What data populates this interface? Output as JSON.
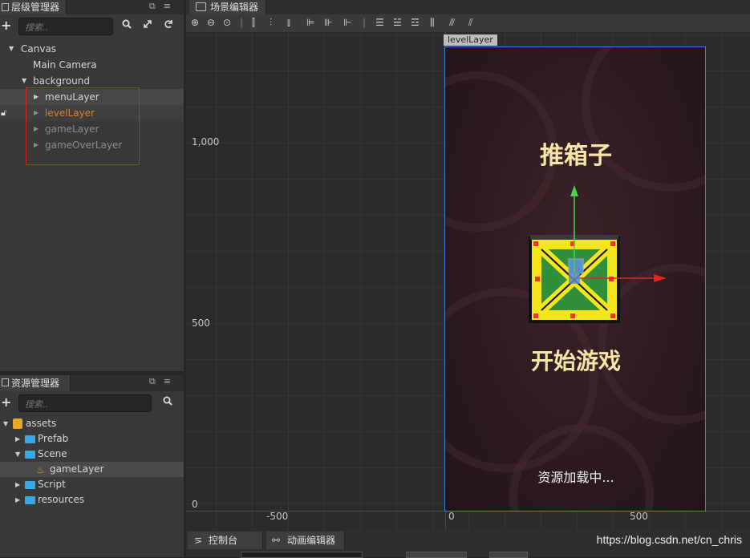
{
  "hierarchy": {
    "title": "层级管理器",
    "search_placeholder": "搜索..",
    "items": [
      {
        "label": "Canvas"
      },
      {
        "label": "Main Camera"
      },
      {
        "label": "background"
      },
      {
        "label": "menuLayer"
      },
      {
        "label": "levelLayer"
      },
      {
        "label": "gameLayer"
      },
      {
        "label": "gameOverLayer"
      }
    ]
  },
  "assets": {
    "title": "资源管理器",
    "search_placeholder": "搜索..",
    "items": [
      {
        "label": "assets"
      },
      {
        "label": "Prefab"
      },
      {
        "label": "Scene"
      },
      {
        "label": "gameLayer"
      },
      {
        "label": "Script"
      },
      {
        "label": "resources"
      }
    ]
  },
  "scene": {
    "title": "场景编辑器",
    "node_tag": "levelLayer",
    "axis_y": [
      "1,000",
      "500",
      "0"
    ],
    "axis_x": [
      "-500",
      "0",
      "500"
    ],
    "game": {
      "title": "推箱子",
      "start": "开始游戏",
      "loading": "资源加载中..."
    }
  },
  "bottom": {
    "console_tab": "控制台",
    "animation_tab": "动画编辑器"
  },
  "watermark": "https://blog.csdn.net/cn_chris",
  "colors": {
    "selection_outline": "#e02020",
    "highlight_text": "#d9822b",
    "frame_border": "#3d7fd9",
    "game_text": "#f4e6a6"
  },
  "icons": [
    "plus-icon",
    "search-icon",
    "expand-icon",
    "refresh-icon",
    "lock-icon",
    "folder-icon",
    "scene-fire-icon",
    "crate-icon"
  ]
}
